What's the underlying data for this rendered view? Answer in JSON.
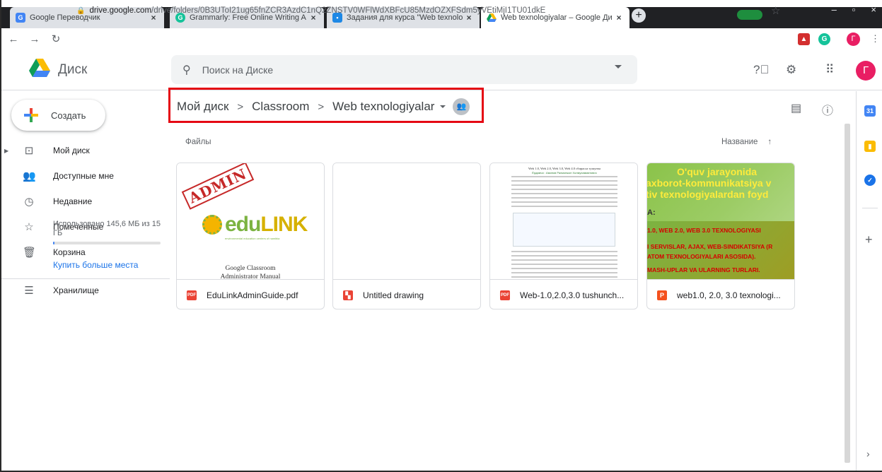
{
  "browser": {
    "tabs": [
      {
        "title": "Google Переводчик",
        "icon": "google-translate-icon"
      },
      {
        "title": "Grammarly: Free Online Writing A",
        "icon": "grammarly-icon"
      },
      {
        "title": "Задания для курса \"Web texnolo",
        "icon": "classroom-icon"
      },
      {
        "title": "Web texnologiyalar – Google Ди",
        "icon": "drive-icon",
        "active": true
      }
    ],
    "new_tab": "+",
    "url_host": "drive.google.com",
    "url_path": "/drive/folders/0B3UToI21ug65fnZCR3AzdC1nQ2ZNSTV0WFlWdXBFcU85MzdOZXFSdm5yVEtiMjI1TU01dkE",
    "profile_letter": "Г"
  },
  "header": {
    "brand": "Диск",
    "search_placeholder": "Поиск на Диске",
    "avatar_letter": "Г"
  },
  "sidebar": {
    "create_label": "Создать",
    "items": [
      {
        "label": "Мой диск",
        "icon": "my-drive-icon"
      },
      {
        "label": "Доступные мне",
        "icon": "shared-with-me-icon"
      },
      {
        "label": "Недавние",
        "icon": "recent-icon"
      },
      {
        "label": "Помеченные",
        "icon": "starred-icon"
      },
      {
        "label": "Корзина",
        "icon": "trash-icon"
      }
    ],
    "storage_label": "Хранилище",
    "storage_usage": "Использовано 145,6 МБ из 15 ГБ",
    "storage_fraction": 0.0095,
    "buy_more": "Купить больше места"
  },
  "main": {
    "breadcrumb": [
      "Мой диск",
      "Classroom",
      "Web texnologiyalar"
    ],
    "breadcrumb_sep": ">",
    "files_label": "Файлы",
    "sort_label": "Название",
    "sort_arrow": "↑",
    "files": [
      {
        "name": "EduLinkAdminGuide.pdf",
        "type": "PDF",
        "type_color": "#ea4335"
      },
      {
        "name": "Untitled drawing",
        "type": "drawing",
        "type_color": "#ea4335"
      },
      {
        "name": "Web-1.0,2.0,3.0 tushunch...",
        "type": "PDF",
        "type_color": "#ea4335"
      },
      {
        "name": "web1.0, 2.0, 3.0 texnologi...",
        "type": "P",
        "type_color": "#f4511e"
      }
    ]
  },
  "thumbs": {
    "admin_stamp": "ADMIN",
    "edulink_a": "edu",
    "edulink_b": "LINK",
    "edulink_sub": "environmental education centers of namibia",
    "manual_line1": "Google Classroom",
    "manual_line2": "Administrator Manual",
    "doc_title": "Web 1.0, Web 2.0, Web 3.0, Web 4.0 сбирасла тушунча",
    "doc_sub": "Ёрдамчи : Аминов Рахмонжон Холмухамматович",
    "slide_title_1": "O'quv jarayonida",
    "slide_title_2": "axborot-kommunikatsiya v",
    "slide_title_3": "tiv texnologiyalardan foyd",
    "slide_4": "A:",
    "slide_red_1": "1.0, WEB 2.0, WEB 3.0 TEXNOLOGIYASI",
    "slide_red_2": "I SERVISLAR, AJAX, WEB-SINDIKATSIYA (R",
    "slide_red_3": "ATOM TEXNOLOGIYALARI ASOSIDA).",
    "slide_red_4": "MASH-UPLAR VA ULARNING TURLARI."
  },
  "colors": {
    "highlight_box": "#e50914",
    "accent": "#1a73e8"
  }
}
